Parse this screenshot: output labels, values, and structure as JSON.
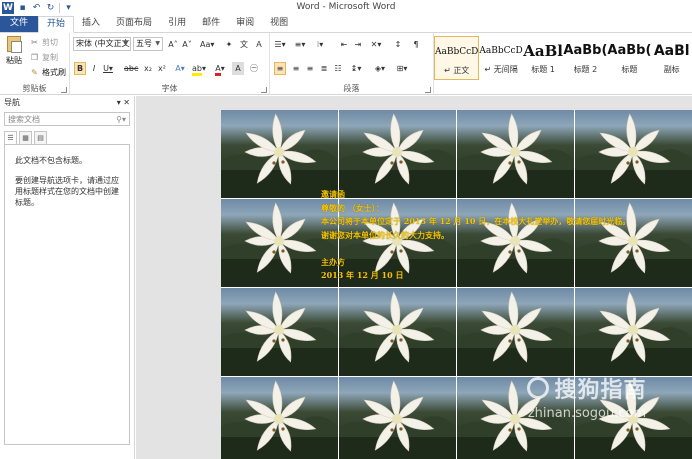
{
  "window": {
    "title": "Word - Microsoft Word"
  },
  "quick_access": [
    "word-logo-icon",
    "save-icon",
    "undo-icon",
    "redo-icon",
    "customize-qat-icon"
  ],
  "tabs": [
    {
      "label": "文件",
      "kind": "file"
    },
    {
      "label": "开始",
      "kind": "active"
    },
    {
      "label": "插入",
      "kind": "normal"
    },
    {
      "label": "页面布局",
      "kind": "normal"
    },
    {
      "label": "引用",
      "kind": "normal"
    },
    {
      "label": "邮件",
      "kind": "normal"
    },
    {
      "label": "审阅",
      "kind": "normal"
    },
    {
      "label": "视图",
      "kind": "normal"
    }
  ],
  "clipboard": {
    "label": "剪贴板",
    "paste": "粘贴",
    "cut": "剪切",
    "copy": "复制",
    "format_painter": "格式刷"
  },
  "font": {
    "label": "字体",
    "font_name": "宋体 (中文正文)",
    "font_size": "五号"
  },
  "paragraph": {
    "label": "段落"
  },
  "styles": {
    "items": [
      {
        "sample": "AaBbCcD",
        "name": "正文",
        "selected": true
      },
      {
        "sample": "AaBbCcD",
        "name": "无间隔",
        "selected": false
      },
      {
        "sample": "AaBl",
        "name": "标题 1",
        "selected": false
      },
      {
        "sample": "AaBb(",
        "name": "标题 2",
        "selected": false
      },
      {
        "sample": "AaBb(",
        "name": "标题",
        "selected": false
      },
      {
        "sample": "AaBl",
        "name": "副标",
        "selected": false
      }
    ]
  },
  "nav": {
    "title": "导航",
    "search_placeholder": "搜索文档",
    "message1": "此文档不包含标题。",
    "message2": "要创建导航选项卡，请通过应用标题样式在您的文档中创建标题。"
  },
  "document": {
    "lines": [
      "邀请函",
      "尊敬的         （女士）：",
      "本公司将于本单位定于 2013 年 12 月 10 日，在本校大礼堂举办，敬请您届时光临。",
      "谢谢您对本单位的长久的大力支持。",
      "",
      "主办方",
      "2013 年 12 月 10 日"
    ],
    "text_color": "#f5c400"
  },
  "watermark": {
    "brand": "搜狗指南",
    "url": "zhinan.sogou.com"
  },
  "colors": {
    "accent": "#2b579a",
    "highlight": "#fce4b8",
    "page_bg": "#e3e3e3"
  }
}
